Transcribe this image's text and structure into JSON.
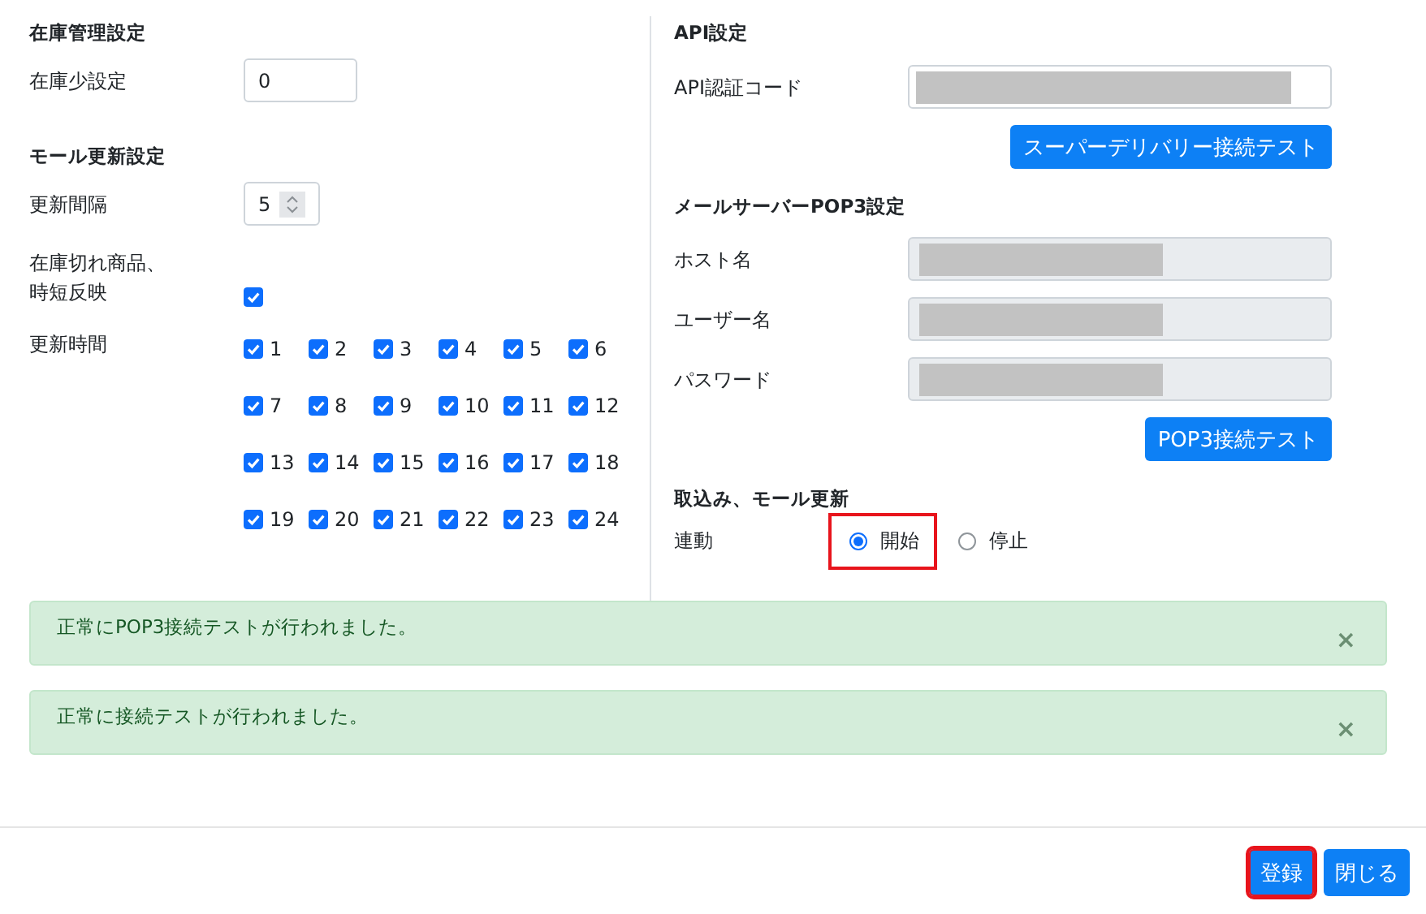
{
  "left": {
    "sections": [
      {
        "heading": "在庫管理設定",
        "rows": [
          {
            "kind": "text",
            "label": "在庫少設定",
            "value": "0"
          }
        ]
      },
      {
        "heading": "モール更新設定",
        "rows": [
          {
            "kind": "number",
            "label": "更新間隔",
            "value": "5"
          },
          {
            "kind": "checkbox",
            "label_lines": [
              "在庫切れ商品、",
              "時短反映"
            ],
            "checked": true
          },
          {
            "kind": "checkgrid",
            "label": "更新時間",
            "options": [
              {
                "label": "1",
                "checked": true
              },
              {
                "label": "2",
                "checked": true
              },
              {
                "label": "3",
                "checked": true
              },
              {
                "label": "4",
                "checked": true
              },
              {
                "label": "5",
                "checked": true
              },
              {
                "label": "6",
                "checked": true
              },
              {
                "label": "7",
                "checked": true
              },
              {
                "label": "8",
                "checked": true
              },
              {
                "label": "9",
                "checked": true
              },
              {
                "label": "10",
                "checked": true
              },
              {
                "label": "11",
                "checked": true
              },
              {
                "label": "12",
                "checked": true
              },
              {
                "label": "13",
                "checked": true
              },
              {
                "label": "14",
                "checked": true
              },
              {
                "label": "15",
                "checked": true
              },
              {
                "label": "16",
                "checked": true
              },
              {
                "label": "17",
                "checked": true
              },
              {
                "label": "18",
                "checked": true
              },
              {
                "label": "19",
                "checked": true
              },
              {
                "label": "20",
                "checked": true
              },
              {
                "label": "21",
                "checked": true
              },
              {
                "label": "22",
                "checked": true
              },
              {
                "label": "23",
                "checked": true
              },
              {
                "label": "24",
                "checked": true
              }
            ]
          }
        ]
      }
    ]
  },
  "right": {
    "sections": [
      {
        "heading": "API設定",
        "rows": [
          {
            "kind": "field",
            "label": "API認証コード",
            "redacted": true,
            "disabled": false
          },
          {
            "kind": "button",
            "label": "スーパーデリバリー接続テスト"
          }
        ]
      },
      {
        "heading": "メールサーバーPOP3設定",
        "rows": [
          {
            "kind": "field",
            "label": "ホスト名",
            "redacted": true,
            "disabled": true
          },
          {
            "kind": "field",
            "label": "ユーザー名",
            "redacted": true,
            "disabled": true
          },
          {
            "kind": "field",
            "label": "パスワード",
            "redacted": true,
            "disabled": true
          },
          {
            "kind": "button",
            "label": "POP3接続テスト"
          }
        ]
      },
      {
        "heading": "取込み、モール更新",
        "rows": [
          {
            "kind": "radio",
            "label": "連動",
            "options": [
              {
                "label": "開始",
                "selected": true,
                "highlighted": true
              },
              {
                "label": "停止",
                "selected": false,
                "highlighted": false
              }
            ]
          }
        ]
      }
    ]
  },
  "alerts": [
    {
      "message": "正常にPOP3接続テストが行われました。",
      "close": "×"
    },
    {
      "message": "正常に接続テストが行われました。",
      "close": "×"
    }
  ],
  "footer_buttons": [
    {
      "label": "登録",
      "highlighted": true
    },
    {
      "label": "閉じる",
      "highlighted": false
    }
  ]
}
